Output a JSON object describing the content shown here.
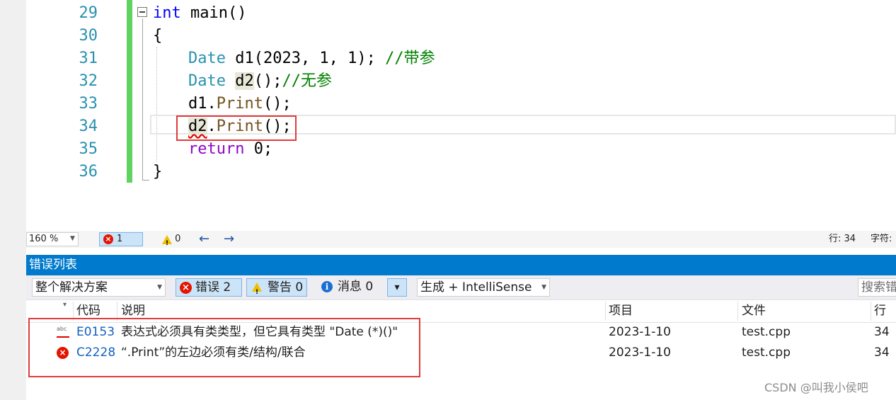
{
  "editor": {
    "line_numbers": [
      "29",
      "30",
      "31",
      "32",
      "33",
      "34",
      "35",
      "36"
    ],
    "code": {
      "l29": {
        "kw": "int",
        "rest": " main()"
      },
      "l30": "{",
      "l31": {
        "type": "Date",
        "mid": " d1(2023, 1, 1); ",
        "comment": "//带参"
      },
      "l32": {
        "type": "Date",
        "var": "d2",
        "mid": "();",
        "comment": "//无参"
      },
      "l33": {
        "obj": "d1.",
        "fn": "Print",
        "rest": "();"
      },
      "l34": {
        "var": "d2",
        "mid": ".",
        "fn": "Print",
        "rest": "();"
      },
      "l35": {
        "kw": "return",
        "rest": " 0;"
      },
      "l36": "}"
    }
  },
  "status": {
    "zoom": "160 %",
    "errors": "1",
    "warnings": "0",
    "line": "行: 34",
    "char": "字符:"
  },
  "error_list": {
    "title": "错误列表",
    "scope": "整个解决方案",
    "errors_btn": "错误 2",
    "warnings_btn": "警告 0",
    "messages_btn": "消息 0",
    "build_filter": "生成 + IntelliSense",
    "search_placeholder": "搜索错误列表",
    "columns": {
      "code": "代码",
      "desc": "说明",
      "project": "项目",
      "file": "文件",
      "line": "行"
    },
    "rows": [
      {
        "icon": "intellisense-squiggle-icon",
        "code": "E0153",
        "desc": "表达式必须具有类类型，但它具有类型 \"Date (*)()\"",
        "project": "2023-1-10",
        "file": "test.cpp",
        "line": "34"
      },
      {
        "icon": "error-icon",
        "code": "C2228",
        "desc": "“.Print”的左边必须有类/结构/联合",
        "project": "2023-1-10",
        "file": "test.cpp",
        "line": "34"
      }
    ]
  },
  "watermark": "CSDN @叫我小侯吧"
}
